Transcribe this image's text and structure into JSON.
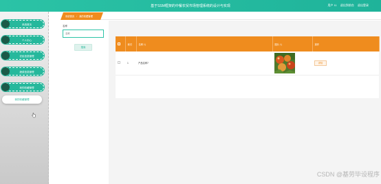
{
  "header": {
    "title": "基于SSM框架的中餐农贸市场管理系统的设计与实现",
    "user_label": "用户 11",
    "logout_label": "退出到前台",
    "exit_label": "退出登录"
  },
  "sidebar": {
    "items": [
      {
        "label": "系统首页"
      },
      {
        "label": "个人中心"
      },
      {
        "label": "农民信息管理"
      },
      {
        "label": "蔬菜信息管理"
      },
      {
        "label": "我的收藏管理"
      },
      {
        "label": "我的收藏管理"
      }
    ],
    "active_index": 5
  },
  "breadcrumb": {
    "home": "系统首页",
    "separator": "/",
    "current": "我的收藏管理"
  },
  "filter": {
    "label": "名称",
    "placeholder": "名称",
    "search_label": "搜索"
  },
  "table": {
    "headers": [
      "",
      "索引",
      "名称 ⇅",
      "图片 ⇅",
      "操作"
    ],
    "rows": [
      {
        "index": "1",
        "name": "产品名称7",
        "action_label": "详情"
      }
    ]
  },
  "watermark": "CSDN @基劳毕设程序",
  "colors": {
    "brand": "#26b89c",
    "accent": "#ef8c1e"
  }
}
